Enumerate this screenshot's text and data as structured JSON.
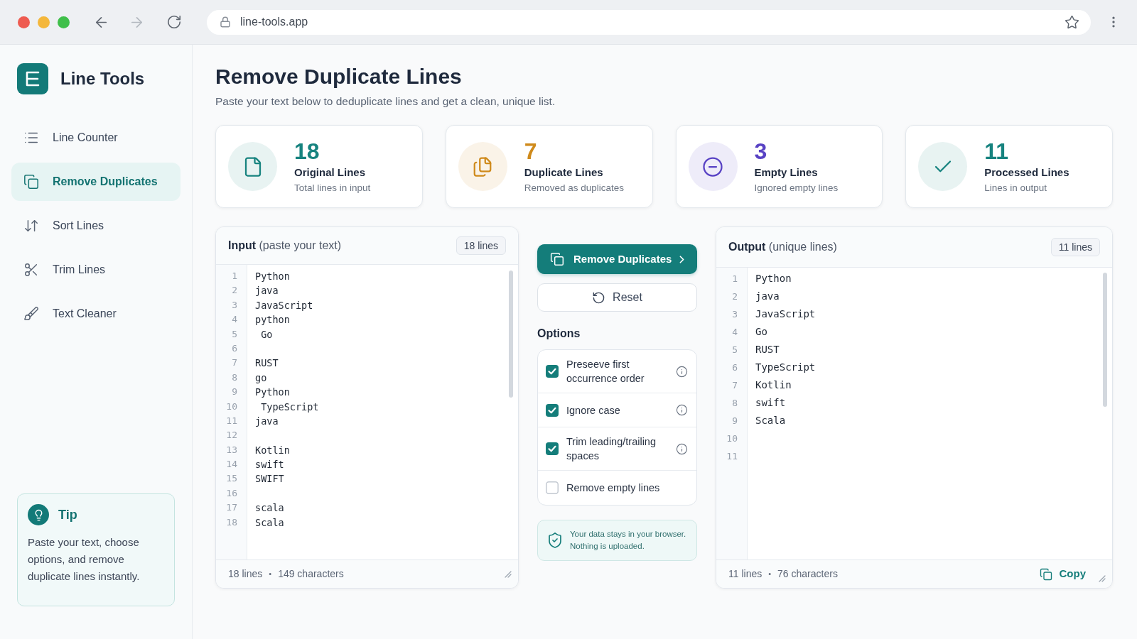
{
  "browser": {
    "url": "line-tools.app",
    "forward_disabled": true
  },
  "sidebar": {
    "app_name": "Line Tools",
    "items": [
      {
        "kind": "counter",
        "label": "Line Counter",
        "selected": false
      },
      {
        "kind": "duplicates",
        "label": "Remove Duplicates",
        "selected": true
      },
      {
        "kind": "sort",
        "label": "Sort Lines",
        "selected": false
      },
      {
        "kind": "trim",
        "label": "Trim Lines",
        "selected": false
      },
      {
        "kind": "cleaner",
        "label": "Text Cleaner",
        "selected": false
      }
    ],
    "tip": {
      "title": "Tip",
      "text": "Paste your text, choose options, and remove duplicate lines instantly."
    }
  },
  "header": {
    "title": "Remove Duplicate Lines",
    "subtitle": "Paste your text below to deduplicate lines and get a clean, unique list."
  },
  "stats": [
    {
      "kind": "original",
      "value": "18",
      "label": "Original Lines",
      "caption": "Total lines in input",
      "color": "#17837f"
    },
    {
      "kind": "duplicate",
      "value": "7",
      "label": "Duplicate Lines",
      "caption": "Removed as duplicates",
      "color": "#cf8a1b"
    },
    {
      "kind": "empty",
      "value": "3",
      "label": "Empty Lines",
      "caption": "Ignored empty lines",
      "color": "#5842c4"
    },
    {
      "kind": "processed",
      "value": "11",
      "label": "Processed Lines",
      "caption": "Lines in output",
      "color": "#17837f"
    }
  ],
  "input": {
    "title": "**Input** (paste your text)",
    "badge": "18 lines",
    "lines": [
      {
        "number": "1",
        "text": "Python"
      },
      {
        "number": "2",
        "text": "java"
      },
      {
        "number": "3",
        "text": "JavaScript"
      },
      {
        "number": "4",
        "text": "python"
      },
      {
        "number": "5",
        "text": " Go"
      },
      {
        "number": "6"
      },
      {
        "number": "7",
        "text": "RUST"
      },
      {
        "number": "8",
        "text": "go"
      },
      {
        "number": "9",
        "text": "Python"
      },
      {
        "number": "10",
        "text": " TypeScript"
      },
      {
        "number": "11",
        "text": "java"
      },
      {
        "number": "12"
      },
      {
        "number": "13",
        "text": "Kotlin"
      },
      {
        "number": "14",
        "text": "swift"
      },
      {
        "number": "15",
        "text": "SWIFT"
      },
      {
        "number": "16"
      },
      {
        "number": "17",
        "text": "scala"
      },
      {
        "number": "18",
        "text": "Scala"
      }
    ],
    "footer": {
      "line_count": "18 lines",
      "separator": "•",
      "char_count": "149 characters"
    }
  },
  "actions": {
    "primary": "Remove Duplicates",
    "reset": "Reset"
  },
  "options": {
    "heading": "Options",
    "items": [
      {
        "label": "Preseeve first occurrence order",
        "checked": true,
        "info": true
      },
      {
        "label": "Ignore case",
        "checked": true,
        "info": true
      },
      {
        "label": "Trim leading/trailing spaces",
        "checked": true,
        "info": true
      },
      {
        "label": "Remove empty lines",
        "checked": false,
        "info": false
      }
    ]
  },
  "privacy_note": "Your data stays in your browser. Nothing is uploaded.",
  "output": {
    "title": "**Output** (unique lines)",
    "badge": "11 lines",
    "lines": [
      {
        "number": "1",
        "text": "Python"
      },
      {
        "number": "2",
        "text": "java"
      },
      {
        "number": "3",
        "text": "JavaScript"
      },
      {
        "number": "4",
        "text": "Go"
      },
      {
        "number": "5",
        "text": "RUST"
      },
      {
        "number": "6",
        "text": "TypeScript"
      },
      {
        "number": "7",
        "text": "Kotlin"
      },
      {
        "number": "8",
        "text": "swift"
      },
      {
        "number": "9",
        "text": "Scala"
      },
      {
        "number": "10"
      },
      {
        "number": "11"
      }
    ],
    "footer": {
      "line_count": "11 lines",
      "separator": "•",
      "char_count": "76 characters"
    },
    "copy": "Copy"
  }
}
